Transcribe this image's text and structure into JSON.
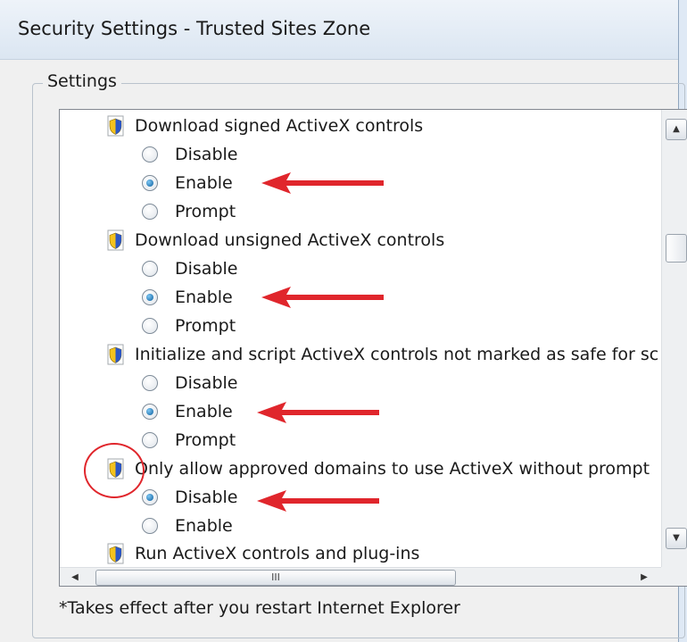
{
  "window": {
    "title": "Security Settings - Trusted Sites Zone"
  },
  "group": {
    "label": "Settings"
  },
  "settings": [
    {
      "heading": "Download signed ActiveX controls",
      "options": [
        {
          "label": "Disable",
          "checked": false
        },
        {
          "label": "Enable",
          "checked": true
        },
        {
          "label": "Prompt",
          "checked": false
        }
      ]
    },
    {
      "heading": "Download unsigned ActiveX controls",
      "options": [
        {
          "label": "Disable",
          "checked": false
        },
        {
          "label": "Enable",
          "checked": true
        },
        {
          "label": "Prompt",
          "checked": false
        }
      ]
    },
    {
      "heading": "Initialize and script ActiveX controls not marked as safe for sc",
      "options": [
        {
          "label": "Disable",
          "checked": false
        },
        {
          "label": "Enable",
          "checked": true
        },
        {
          "label": "Prompt",
          "checked": false
        }
      ]
    },
    {
      "heading": "Only allow approved domains to use ActiveX without prompt",
      "options": [
        {
          "label": "Disable",
          "checked": true
        },
        {
          "label": "Enable",
          "checked": false
        }
      ]
    },
    {
      "heading": "Run ActiveX controls and plug-ins",
      "options": []
    }
  ],
  "scrollbars": {
    "up": "▲",
    "down": "▼",
    "left": "◀",
    "right": "▶",
    "grip": "III"
  },
  "footnote": "*Takes effect after you restart Internet Explorer",
  "annotation": {
    "color": "#e0262c"
  }
}
